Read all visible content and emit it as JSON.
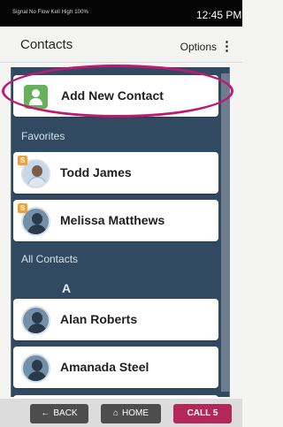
{
  "status_bar": {
    "left_text": "Signal  No Flow  Kell  High  100%",
    "time": "12:45 PM"
  },
  "header": {
    "title": "Contacts",
    "options_label": "Options",
    "options_icon": "⋮"
  },
  "add_contact": {
    "label": "Add New Contact",
    "icon": "add-contact-icon"
  },
  "sections": {
    "favorites": "Favorites",
    "all_contacts": "All Contacts",
    "letter": "A"
  },
  "favorites": [
    {
      "name": "Todd James",
      "badge": "S"
    },
    {
      "name": "Melissa Matthews",
      "badge": "S"
    }
  ],
  "contacts": [
    {
      "name": "Alan Roberts"
    },
    {
      "name": "Amanada Steel"
    }
  ],
  "bottom_nav": {
    "back_label": "BACK",
    "home_label": "HOME",
    "call_label": "CALL",
    "call_icon": "5"
  }
}
